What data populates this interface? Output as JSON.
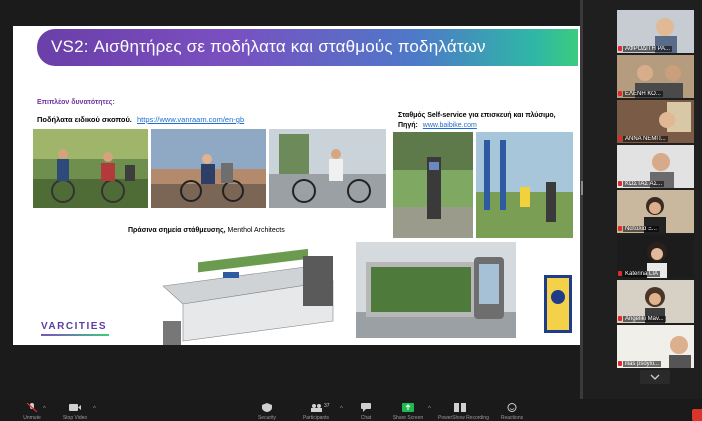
{
  "slide": {
    "title": "VS2: Αισθητήρες σε ποδήλατα και σταθμούς ποδηλάτων",
    "more_options": "Επιπλέον δυνατότητες:",
    "special_bikes": "Ποδήλατα ειδικού σκοπού.",
    "special_bikes_link": "https://www.vanraam.com/en-gb",
    "station_title": "Σταθμός Self-service για επισκευή και πλύσιμο,",
    "station_source": "Πηγή:",
    "station_link": "www.baibike.com",
    "green_points_bold": "Πράσινα σημεία στάθμευσης,",
    "green_points_rest": " Menthol Architects",
    "logo": "VARCITIES"
  },
  "participants": [
    {
      "name": "ΑΦΡΟΔΙΤΗ ΡΑ..."
    },
    {
      "name": "ΕΛΕΝΗ ΚΟ..."
    },
    {
      "name": "ΑΝΝΑ ΝΕΜΠ..."
    },
    {
      "name": "ΚΩΣΤΑΣ ΑΣ..."
    },
    {
      "name": "Ναταλία Ξ..."
    },
    {
      "name": "Katerina LIA"
    },
    {
      "name": "Angeliki Mav..."
    },
    {
      "name": "ilias psoyxi..."
    }
  ],
  "toolbar": {
    "unmute": "Unmute",
    "stop_video": "Stop Video",
    "security": "Security",
    "participants": "Participants",
    "participants_count": "37",
    "chat": "Chat",
    "share_screen": "Share Screen",
    "recording": "PowerShow Recording",
    "reactions": "Reactions"
  },
  "colors": {
    "title_start": "#6b3fa8",
    "title_end": "#3ccc7e",
    "link": "#1f6fd1",
    "accent_purple": "#7030a0",
    "share_green": "#1fb954",
    "end_red": "#d9352b"
  }
}
